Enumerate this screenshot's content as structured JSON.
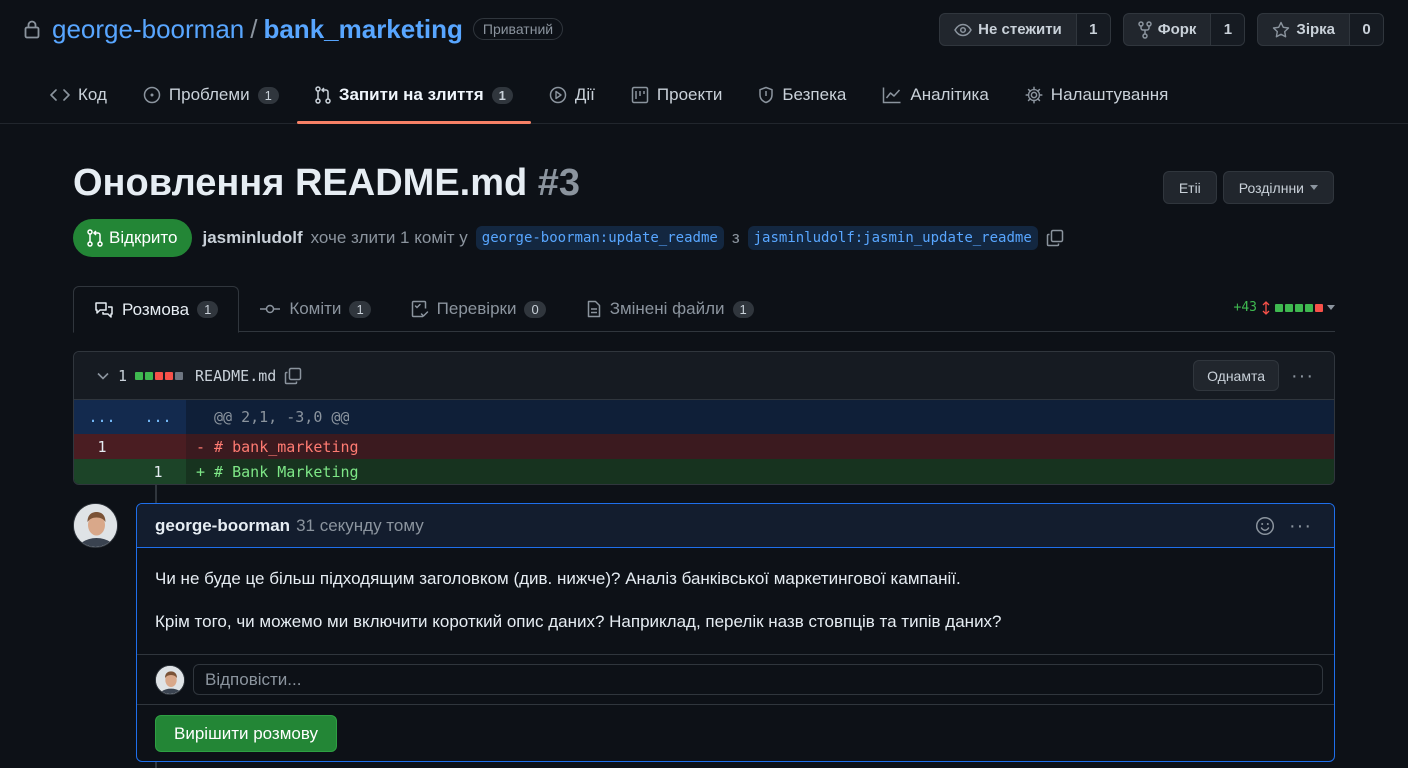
{
  "repo": {
    "owner": "george-boorman",
    "separator": "/",
    "name": "bank_marketing",
    "visibility": "Приватний"
  },
  "header_actions": {
    "watch": {
      "label": "Не стежити",
      "count": "1"
    },
    "fork": {
      "label": "Форк",
      "count": "1"
    },
    "star": {
      "label": "Зірка",
      "count": "0"
    }
  },
  "nav": {
    "items": [
      {
        "label": "Код",
        "icon": "code-icon"
      },
      {
        "label": "Проблеми",
        "count": "1",
        "icon": "issue-icon"
      },
      {
        "label": "Запити на злиття",
        "count": "1",
        "icon": "pull-request-icon",
        "active": true
      },
      {
        "label": "Дії",
        "icon": "play-icon"
      },
      {
        "label": "Проекти",
        "icon": "project-icon"
      },
      {
        "label": "Безпека",
        "icon": "shield-icon"
      },
      {
        "label": "Аналітика",
        "icon": "graph-icon"
      },
      {
        "label": "Налаштування",
        "icon": "gear-icon"
      }
    ]
  },
  "pr": {
    "title": "Оновлення README.md",
    "number": "#3",
    "edit_label": "Етіі",
    "view_label": "Розділнни",
    "state": "Відкрито",
    "author": "jasminludolf",
    "meta_text": "хоче злити 1 коміт у",
    "base_branch": "george-boorman:update_readme",
    "from_word": "з",
    "head_branch": "jasminludolf:jasmin_update_readme"
  },
  "tabs": [
    {
      "label": "Розмова",
      "count": "1",
      "active": true,
      "icon": "comment-icon"
    },
    {
      "label": "Коміти",
      "count": "1",
      "icon": "commit-icon"
    },
    {
      "label": "Перевірки",
      "count": "0",
      "icon": "checklist-icon"
    },
    {
      "label": "Змінені файли",
      "count": "1",
      "icon": "file-icon"
    }
  ],
  "diffstat": {
    "additions": "+43",
    "colors": {
      "add": "#3fb950",
      "del": "#f85149"
    }
  },
  "file": {
    "change_count": "1",
    "name": "README.md",
    "button_label": "Однамта",
    "hunk": {
      "old": "...",
      "new": "...",
      "header": "@@ 2,1, -3,0 @@"
    },
    "lines": [
      {
        "type": "del",
        "old": "1",
        "new": "",
        "text": "- # bank_marketing"
      },
      {
        "type": "add",
        "old": "",
        "new": "1",
        "text": "+ # Bank Marketing"
      }
    ]
  },
  "comment": {
    "author": "george-boorman",
    "time": "31 секунду тому",
    "paragraphs": [
      "Чи не буде це більш підходящим заголовком (див. нижче)? Аналіз банківської маркетингової кампанії.",
      "Крім того, чи можемо ми включити короткий опис даних? Наприклад, перелік назв стовпців та типів даних?"
    ],
    "reply_placeholder": "Відповісти...",
    "resolve_label": "Вирішити розмову"
  }
}
